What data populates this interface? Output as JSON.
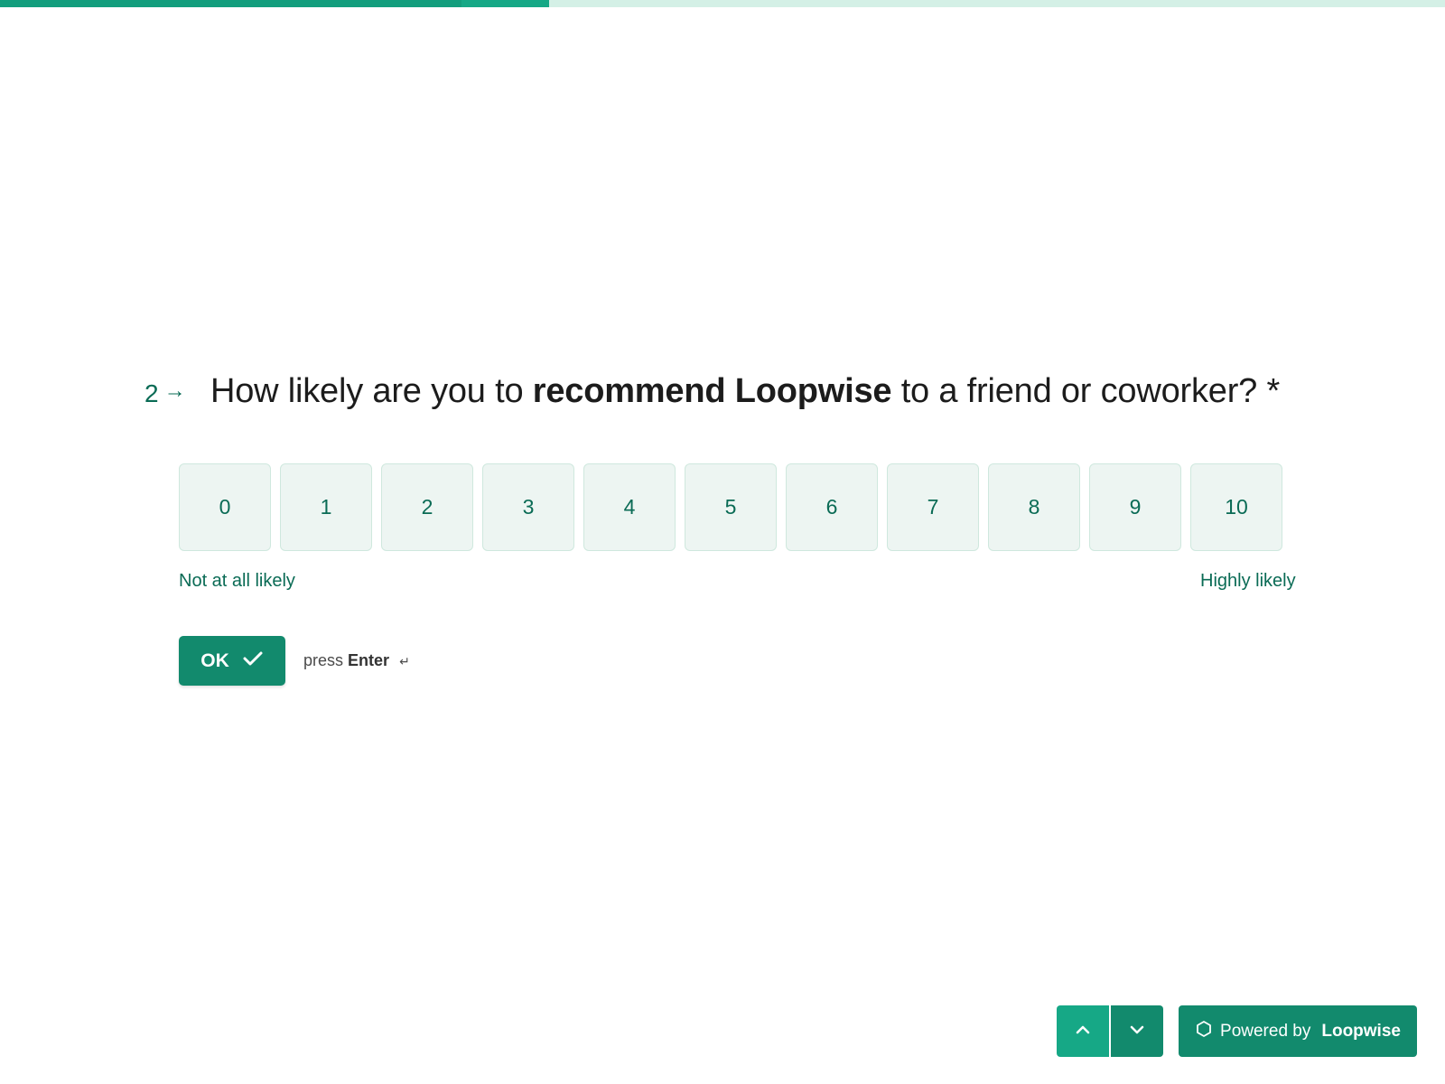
{
  "progress": {
    "fraction": 0.38
  },
  "question": {
    "number": "2",
    "arrow_icon": "arrow-right-icon",
    "text_before": "How likely are you to ",
    "text_bold": "recommend Loopwise",
    "text_after": " to a friend or coworker?",
    "required_marker": " *"
  },
  "scale": {
    "options": [
      "0",
      "1",
      "2",
      "3",
      "4",
      "5",
      "6",
      "7",
      "8",
      "9",
      "10"
    ],
    "low_label": "Not at all likely",
    "high_label": "Highly likely"
  },
  "submit": {
    "label": "OK",
    "icon": "checkmark-icon",
    "hint_prefix": "press",
    "hint_key": "Enter",
    "hint_icon": "enter-key-icon"
  },
  "navigation": {
    "up_icon": "chevron-up-icon",
    "down_icon": "chevron-down-icon"
  },
  "branding": {
    "prefix": "Powered by",
    "brand": "Loopwise",
    "icon": "hexagon-icon"
  },
  "colors": {
    "accent": "#128a6d",
    "accent_light": "#16a886",
    "option_bg": "#edf5f2",
    "text_green": "#0a6b55"
  }
}
